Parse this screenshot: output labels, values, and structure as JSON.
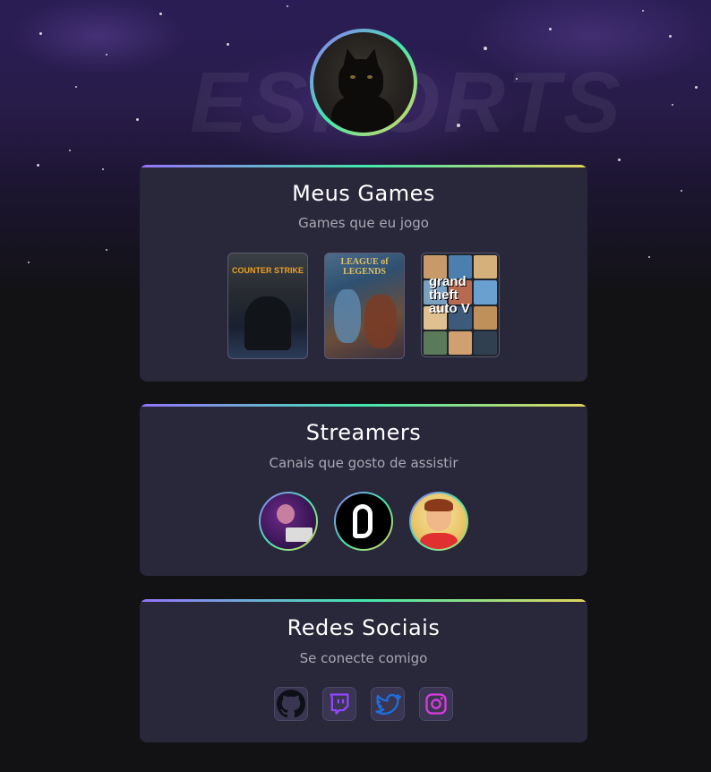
{
  "background": {
    "watermark_text": "ESPORTS",
    "colors": {
      "top": "#2a1d55",
      "bottom": "#121214"
    }
  },
  "profile": {
    "avatar": "black-cat-photo",
    "ring_gradient": [
      "#9572fc",
      "#43e7ad",
      "#e2d45c"
    ]
  },
  "games": {
    "title": "Meus Games",
    "subtitle": "Games que eu jogo",
    "items": [
      {
        "name": "Counter-Strike",
        "cover_text": "COUNTER STRIKE"
      },
      {
        "name": "League of Legends",
        "cover_text": "LEAGUE of LEGENDS"
      },
      {
        "name": "Grand Theft Auto V",
        "cover_text": "grand theft auto V"
      }
    ]
  },
  "streamers": {
    "title": "Streamers",
    "subtitle": "Canais que gosto de assistir",
    "items": [
      {
        "name": "streamer-1"
      },
      {
        "name": "streamer-2"
      },
      {
        "name": "streamer-3"
      }
    ]
  },
  "social": {
    "title": "Redes Sociais",
    "subtitle": "Se conecte comigo",
    "items": [
      {
        "name": "github",
        "icon": "github-icon",
        "color": "#0d1117"
      },
      {
        "name": "twitch",
        "icon": "twitch-icon",
        "color": "#9146ff"
      },
      {
        "name": "twitter",
        "icon": "twitter-icon",
        "color": "#1d6fe0"
      },
      {
        "name": "instagram",
        "icon": "instagram-icon",
        "color": "#d93ae0"
      }
    ]
  },
  "colors": {
    "card_bg": "#29273a",
    "title": "#ffffff",
    "subtitle": "#a9a8b3"
  }
}
